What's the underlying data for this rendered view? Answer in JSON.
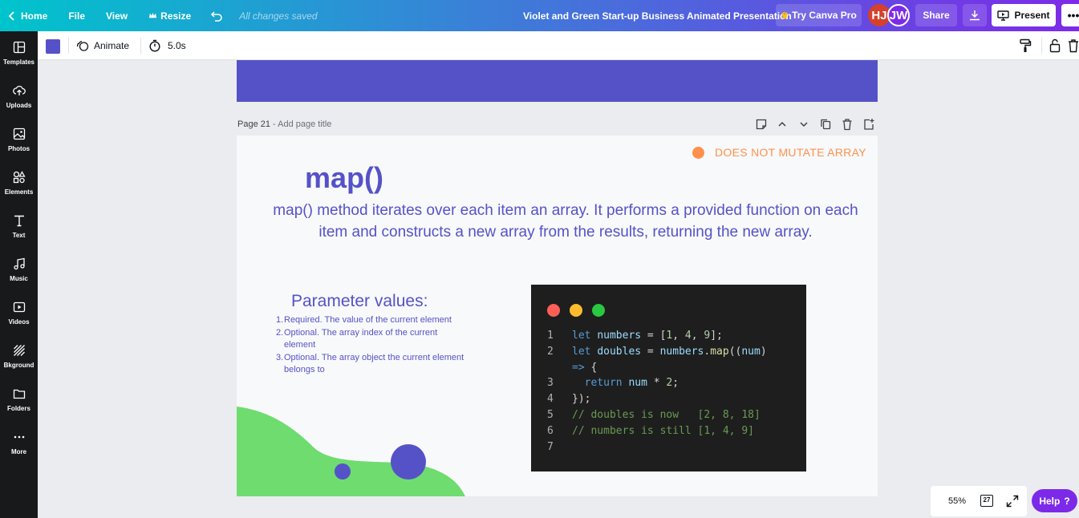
{
  "topbar": {
    "home": "Home",
    "file": "File",
    "view": "View",
    "resize": "Resize",
    "saved_status": "All changes saved",
    "title": "Violet and Green Start-up Business Animated Presentation",
    "try_pro": "Try Canva Pro",
    "avatars": [
      "HJ",
      "JW"
    ],
    "share": "Share",
    "present": "Present"
  },
  "sidebar": {
    "items": [
      {
        "label": "Templates",
        "icon": "templates-icon"
      },
      {
        "label": "Uploads",
        "icon": "upload-icon"
      },
      {
        "label": "Photos",
        "icon": "photos-icon"
      },
      {
        "label": "Elements",
        "icon": "elements-icon"
      },
      {
        "label": "Text",
        "icon": "text-icon"
      },
      {
        "label": "Music",
        "icon": "music-icon"
      },
      {
        "label": "Videos",
        "icon": "videos-icon"
      },
      {
        "label": "Bkground",
        "icon": "background-icon"
      },
      {
        "label": "Folders",
        "icon": "folder-icon"
      },
      {
        "label": "More",
        "icon": "more-icon"
      }
    ]
  },
  "toolbar": {
    "color": "#5552c8",
    "animate": "Animate",
    "duration": "5.0s"
  },
  "page": {
    "number_label": "Page 21",
    "separator": " - ",
    "add_title": "Add page title"
  },
  "slide": {
    "badge": "DOES NOT MUTATE ARRAY",
    "title": "map()",
    "description": "map() method iterates over each item an array. It performs a provided function on each item and constructs a new array from the results, returning the new array.",
    "param_heading": "Parameter values:",
    "params": [
      {
        "num": "1.",
        "text": "Required. The value of the current element"
      },
      {
        "num": "2.",
        "text": "Optional. The array index of the current element"
      },
      {
        "num": "3.",
        "text": "Optional. The array object the current element belongs to"
      }
    ],
    "code_line_numbers": [
      "1",
      "2",
      "",
      "3",
      "4",
      "5",
      "6",
      "7"
    ]
  },
  "colors": {
    "brand_purple": "#7d2ae8",
    "slide_violet": "#5552c8",
    "slide_green": "#6fdc6f",
    "badge_orange": "#ff914d",
    "mac_red": "#ff5f57",
    "mac_yellow": "#febc2e",
    "mac_green": "#28c840"
  },
  "bottom": {
    "zoom": "55%",
    "page_count": "27",
    "help": "Help",
    "help_mark": "?"
  }
}
